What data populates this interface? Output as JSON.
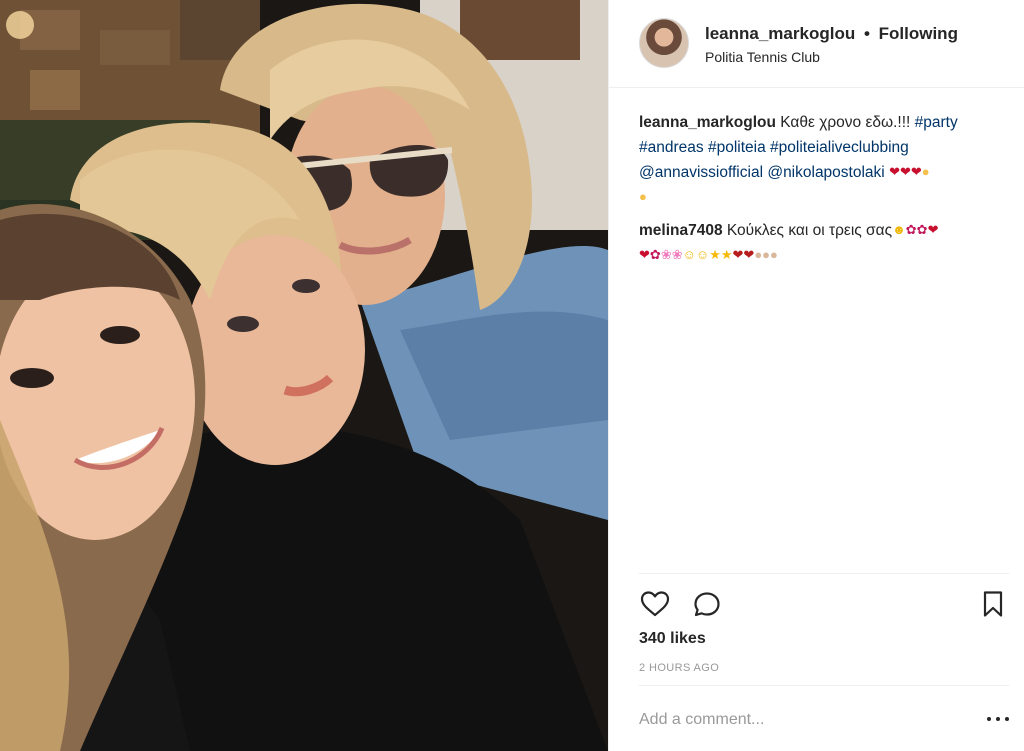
{
  "post": {
    "username": "leanna_markoglou",
    "separator": "•",
    "follow_status": "Following",
    "location": "Politia Tennis Club"
  },
  "caption": {
    "user": "leanna_markoglou",
    "text": "Καθε χρονο εδω.!!!",
    "tags": [
      "#party",
      "#andreas",
      "#politeia",
      "#politeialiveclubbing",
      "@annavissiofficial",
      "@nikolapostolaki"
    ]
  },
  "comment2": {
    "user": "melina7408",
    "text": "Κούκλες και οι τρεις σας"
  },
  "icons": {
    "like": "heart-outline-icon",
    "comment": "comment-bubble-icon",
    "save": "bookmark-icon",
    "more": "more-options-icon"
  },
  "stats": {
    "likes": "340 likes",
    "time": "2 HOURS AGO"
  },
  "add_comment": {
    "placeholder": "Add a comment..."
  },
  "colors": {
    "text": "#262626",
    "link": "#003569",
    "muted": "#999999",
    "divider": "#efefef"
  }
}
